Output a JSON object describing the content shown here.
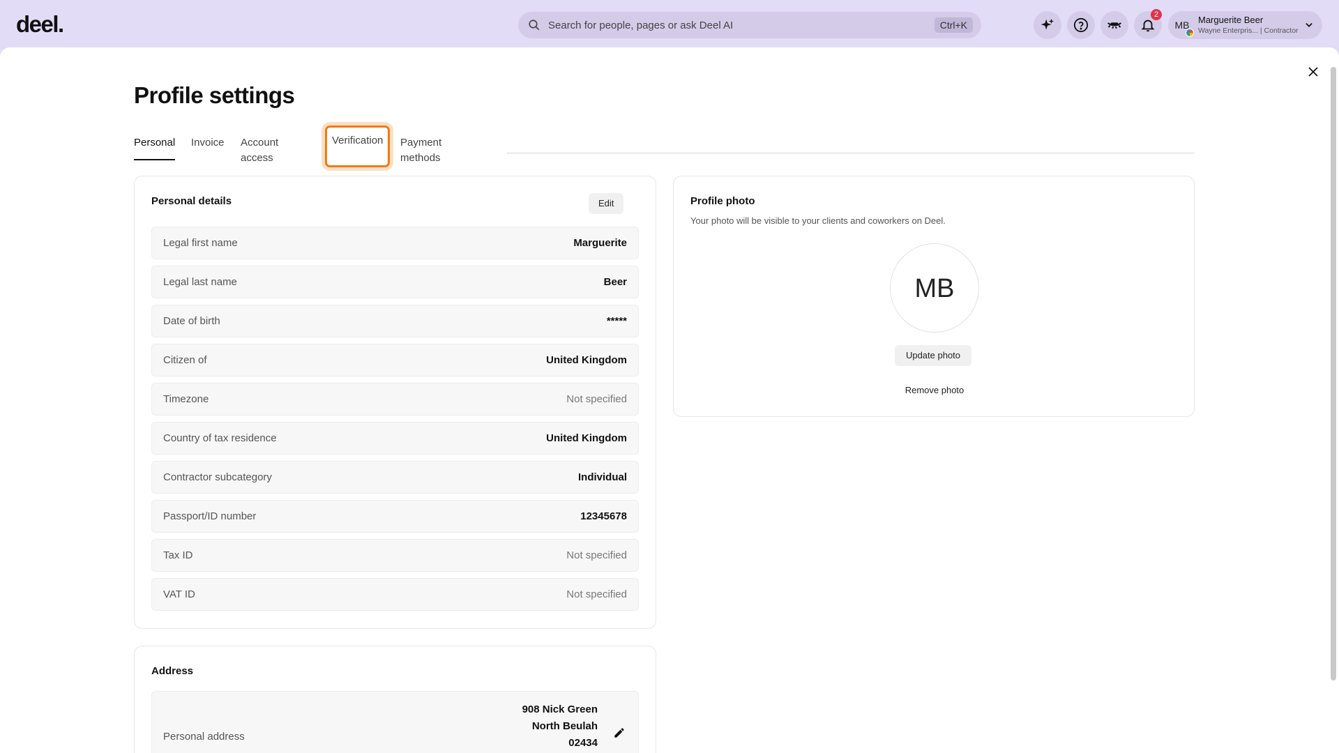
{
  "app": {
    "logo": "deel."
  },
  "search": {
    "placeholder": "Search for people, pages or ask Deel AI",
    "shortcut": "Ctrl+K"
  },
  "header_icons": {
    "ai": "sparkle-icon",
    "help": "help-circle-icon",
    "eye": "closed-eye-icon",
    "bell": "bell-icon",
    "notification_count": "2"
  },
  "user": {
    "initials": "MB",
    "name": "Marguerite Beer",
    "subtitle": "Wayne Enterpris... | Contractor"
  },
  "page": {
    "title": "Profile settings"
  },
  "tabs": [
    {
      "label": "Personal",
      "active": true
    },
    {
      "label": "Invoice"
    },
    {
      "label": "Account access"
    },
    {
      "label": "Verification",
      "focused": true
    },
    {
      "label": "Payment methods"
    }
  ],
  "personal_details": {
    "title": "Personal details",
    "edit_label": "Edit",
    "rows": [
      {
        "label": "Legal first name",
        "value": "Marguerite"
      },
      {
        "label": "Legal last name",
        "value": "Beer"
      },
      {
        "label": "Date of birth",
        "value": "*****"
      },
      {
        "label": "Citizen of",
        "value": "United Kingdom"
      },
      {
        "label": "Timezone",
        "value": "Not specified",
        "muted": true
      },
      {
        "label": "Country of tax residence",
        "value": "United Kingdom"
      },
      {
        "label": "Contractor subcategory",
        "value": "Individual"
      },
      {
        "label": "Passport/ID number",
        "value": "12345678"
      },
      {
        "label": "Tax ID",
        "value": "Not specified",
        "muted": true
      },
      {
        "label": "VAT ID",
        "value": "Not specified",
        "muted": true
      }
    ]
  },
  "address": {
    "title": "Address",
    "label": "Personal address",
    "lines": [
      "908 Nick Green",
      "North Beulah",
      "02434"
    ]
  },
  "profile_photo": {
    "title": "Profile photo",
    "description": "Your photo will be visible to your clients and coworkers on Deel.",
    "initials": "MB",
    "update_label": "Update photo",
    "remove_label": "Remove photo"
  }
}
